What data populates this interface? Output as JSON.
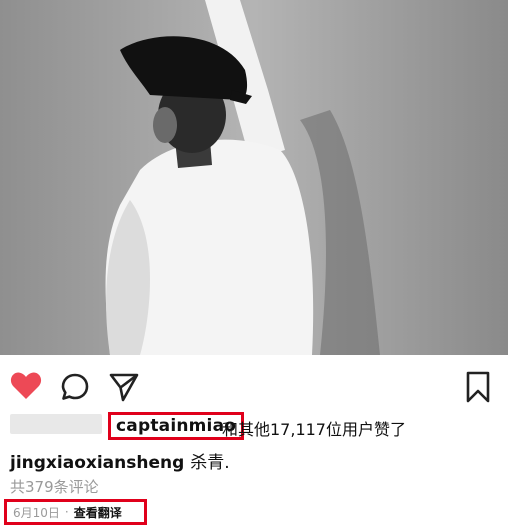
{
  "post": {
    "liker_name": "captainmiao",
    "likes_suffix": "和其他17,117位用户赞了",
    "caption_user": "jingxiaoxiansheng",
    "caption_text": "杀青.",
    "comments_link": "共379条评论",
    "date": "6月10日",
    "separator": "·",
    "translate_label": "查看翻译",
    "liked": true
  },
  "icons": {
    "heart": "heart-icon",
    "comment": "comment-icon",
    "share": "send-icon",
    "bookmark": "bookmark-icon"
  },
  "colors": {
    "heart": "#ed4956",
    "highlight_box": "#e0001b",
    "muted_text": "#9a9a9a"
  }
}
